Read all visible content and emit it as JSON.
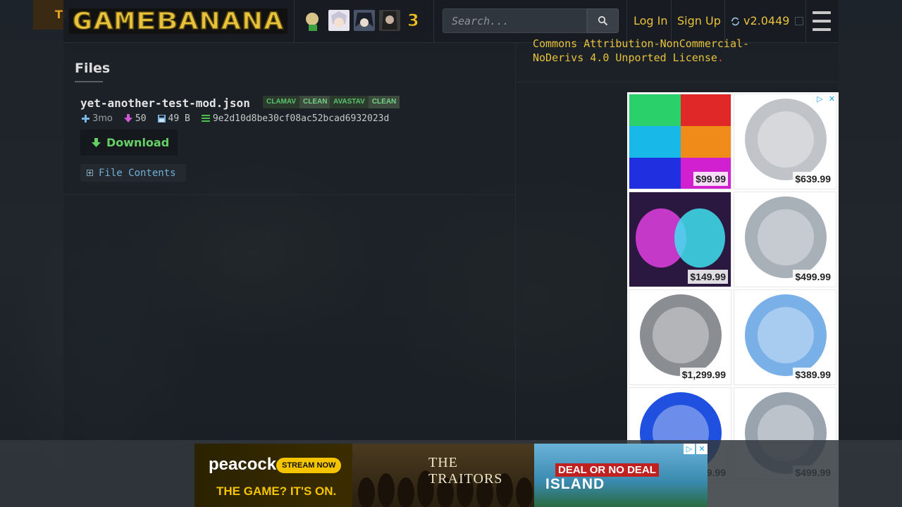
{
  "site": {
    "logo_text": "GAMEBANANA",
    "corner_promo": "TI"
  },
  "header": {
    "search_placeholder": "Search...",
    "login": "Log In",
    "signup": "Sign Up",
    "version": "v2.0449",
    "featured_badge": "3"
  },
  "license": {
    "line1": "Commons Attribution-NonCommercial-",
    "line2": "NoDerivs 4.0 Unported License",
    "end": "."
  },
  "files": {
    "title": "Files",
    "file": {
      "name": "yet-another-test-mod.json",
      "scans": [
        {
          "name": "CLAMAV",
          "result": "CLEAN"
        },
        {
          "name": "AVASTAV",
          "result": "CLEAN"
        }
      ],
      "age": "3mo",
      "downloads": "50",
      "size": "49 B",
      "md5": "9e2d10d8be30cf08ac52bcad6932023d"
    },
    "download_label": "Download",
    "contents_label": "File Contents"
  },
  "ad_right": {
    "products": [
      {
        "price": "$99.99",
        "colors": [
          "#2ad06a",
          "#e02828",
          "#18b8e8",
          "#f08a18",
          "#2030e0",
          "#d020d0"
        ]
      },
      {
        "price": "$639.99",
        "colors": [
          "#c0c4c8"
        ]
      },
      {
        "price": "$149.99",
        "colors": [
          "#e040e0",
          "#40e0f0"
        ]
      },
      {
        "price": "$499.99",
        "colors": [
          "#a8b0b8"
        ]
      },
      {
        "price": "$1,299.99",
        "colors": [
          "#8a8e92"
        ]
      },
      {
        "price": "$389.99",
        "colors": [
          "#7ab0e8"
        ]
      },
      {
        "price": "$269.99",
        "colors": [
          "#2050e0"
        ]
      },
      {
        "price": "$499.99",
        "colors": [
          "#9aa4ae"
        ]
      }
    ]
  },
  "ad_bottom": {
    "brand": "peacock",
    "cta": "STREAM NOW",
    "tagline": "THE GAME? IT'S ON.",
    "show1": "THE TRAITORS",
    "show2_top": "DEAL OR NO DEAL",
    "show2_bottom": "ISLAND"
  }
}
